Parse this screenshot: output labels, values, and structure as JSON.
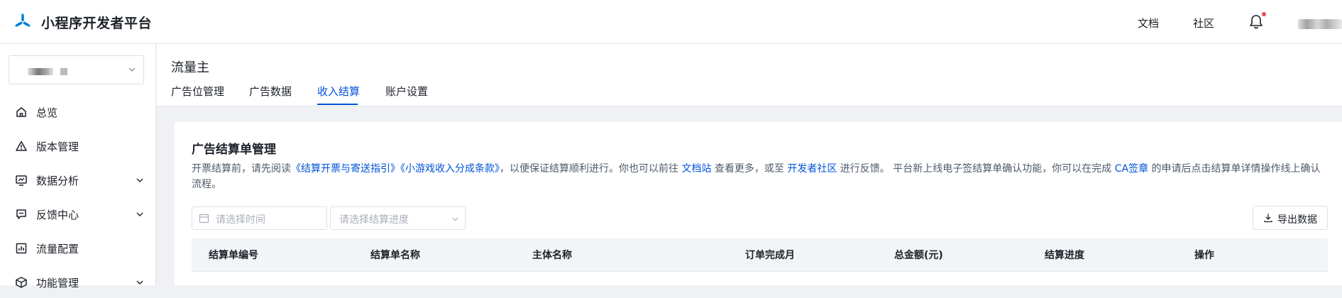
{
  "app": {
    "title": "小程序开发者平台"
  },
  "topnav": {
    "docs": "文档",
    "community": "社区"
  },
  "sidebar": {
    "items": [
      {
        "label": "总览",
        "icon": "home-icon"
      },
      {
        "label": "版本管理",
        "icon": "warning-triangle-icon"
      },
      {
        "label": "数据分析",
        "icon": "chart-icon",
        "expandable": true
      },
      {
        "label": "反馈中心",
        "icon": "feedback-icon",
        "expandable": true
      },
      {
        "label": "流量配置",
        "icon": "traffic-icon"
      },
      {
        "label": "功能管理",
        "icon": "box-icon",
        "expandable": true
      }
    ]
  },
  "page": {
    "title": "流量主",
    "tabs": [
      {
        "label": "广告位管理",
        "active": false
      },
      {
        "label": "广告数据",
        "active": false
      },
      {
        "label": "收入结算",
        "active": true
      },
      {
        "label": "账户设置",
        "active": false
      }
    ]
  },
  "card": {
    "title": "广告结算单管理",
    "notice": {
      "p1": "开票结算前，请先阅读",
      "link1": "《结算开票与寄送指引》",
      "link2": "《小游戏收入分成条款》",
      "p2": "，以便保证结算顺利进行。你也可以前往 ",
      "link3": "文档站",
      "p3": " 查看更多，或至 ",
      "link4": "开发者社区",
      "p4": " 进行反馈。 平台新上线电子签结算单确认功能，你可以在完成 ",
      "link5": "CA签章",
      "p5": " 的申请后点击结算单详情操作线上确认流程。"
    },
    "filters": {
      "date_placeholder": "请选择时间",
      "progress_placeholder": "请选择结算进度"
    },
    "export_label": "导出数据",
    "table": {
      "columns": [
        "结算单编号",
        "结算单名称",
        "主体名称",
        "订单完成月",
        "总金额(元)",
        "结算进度",
        "操作"
      ]
    }
  },
  "colors": {
    "accent": "#0052d9",
    "brand": "#07c160",
    "notify_dot": "#e34d59"
  }
}
